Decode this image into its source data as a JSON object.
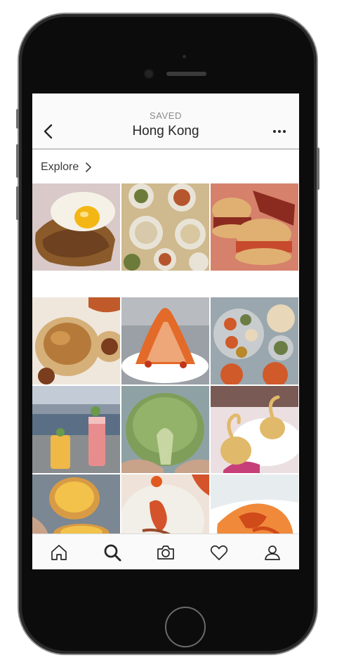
{
  "header": {
    "kicker": "SAVED",
    "title": "Hong Kong",
    "back_icon": "chevron-left-icon",
    "more_icon": "more-horizontal-icon"
  },
  "explore": {
    "label": "Explore",
    "chevron_icon": "chevron-right-icon"
  },
  "grid": {
    "items": [
      {
        "subject": "fried egg on hash",
        "palette": [
          "#d9c9c9",
          "#8a5a2a",
          "#f6f1e6",
          "#f3b614"
        ]
      },
      {
        "subject": "dim sum spread",
        "palette": [
          "#cfb98e",
          "#e8e3d6",
          "#b6562f",
          "#6c7b3a"
        ]
      },
      {
        "subject": "burgers and fries",
        "palette": [
          "#c74a2e",
          "#e0b072",
          "#f0e7dc",
          "#8b2b1f"
        ]
      },
      {
        "subject": "roast chicken",
        "palette": [
          "#b57a3a",
          "#efe7dc",
          "#7a3d1d",
          "#d6b079"
        ]
      },
      {
        "subject": "tomato pasta",
        "palette": [
          "#9aa0a6",
          "#e46a2a",
          "#f1c29a",
          "#ffffff"
        ]
      },
      {
        "subject": "indian thali",
        "palette": [
          "#9aa7ae",
          "#d15a2a",
          "#e8d7b8",
          "#6b7d45"
        ]
      },
      {
        "subject": "harbour drinks",
        "palette": [
          "#c3ccd6",
          "#e88d8d",
          "#f0b847",
          "#5a6f86"
        ]
      },
      {
        "subject": "green pineapple bun",
        "palette": [
          "#8ea2a6",
          "#7f9e5a",
          "#c8d6a4",
          "#6a5a3a"
        ]
      },
      {
        "subject": "swan pastries",
        "palette": [
          "#ebdfe1",
          "#e1b96a",
          "#c73f79",
          "#ffffff"
        ]
      },
      {
        "subject": "egg tarts",
        "palette": [
          "#7b8792",
          "#f2c24a",
          "#d89b45",
          "#6a5a54"
        ]
      },
      {
        "subject": "lobster dish",
        "palette": [
          "#efe2d8",
          "#d4532a",
          "#f2efe8",
          "#9a4a2a"
        ]
      },
      {
        "subject": "orange noodles",
        "palette": [
          "#e7ecef",
          "#f08a3a",
          "#d14a1a",
          "#ffffff"
        ]
      }
    ]
  },
  "tabbar": {
    "tabs": [
      {
        "name": "home",
        "icon": "home-icon"
      },
      {
        "name": "search",
        "icon": "search-icon",
        "active": true
      },
      {
        "name": "camera",
        "icon": "camera-icon"
      },
      {
        "name": "activity",
        "icon": "heart-icon"
      },
      {
        "name": "profile",
        "icon": "profile-icon"
      }
    ]
  },
  "colors": {
    "header_bg": "#fafafa",
    "text_primary": "#262626",
    "text_secondary": "#8a8a8a",
    "device_body": "#0c0c0c"
  }
}
